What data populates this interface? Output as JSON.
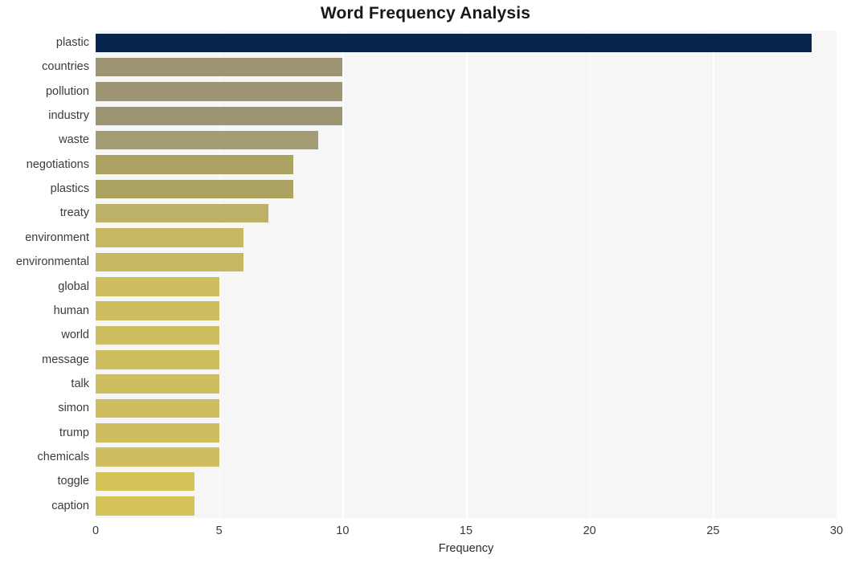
{
  "chart_data": {
    "type": "bar",
    "orientation": "horizontal",
    "title": "Word Frequency Analysis",
    "xlabel": "Frequency",
    "ylabel": "",
    "xlim": [
      0,
      30
    ],
    "ylim": null,
    "grid": true,
    "grid_axis": "x",
    "legend": null,
    "xticks": [
      0,
      5,
      10,
      15,
      20,
      25,
      30
    ],
    "xtick_labels": [
      "0",
      "5",
      "10",
      "15",
      "20",
      "25",
      "30"
    ],
    "categories": [
      "plastic",
      "countries",
      "pollution",
      "industry",
      "waste",
      "negotiations",
      "plastics",
      "treaty",
      "environment",
      "environmental",
      "global",
      "human",
      "world",
      "message",
      "talk",
      "simon",
      "trump",
      "chemicals",
      "toggle",
      "caption"
    ],
    "values": [
      29,
      10,
      10,
      10,
      9,
      8,
      8,
      7,
      6,
      6,
      5,
      5,
      5,
      5,
      5,
      5,
      5,
      5,
      4,
      4
    ],
    "bar_colors": [
      "#07264d",
      "#9d9572",
      "#9d9572",
      "#9d9572",
      "#a49c74",
      "#aca262",
      "#aca262",
      "#bdb067",
      "#c6b763",
      "#c6b763",
      "#cfbe60",
      "#cfbe60",
      "#cfbe60",
      "#cfbe60",
      "#cfbe60",
      "#cfbe60",
      "#cfbe60",
      "#cfbe60",
      "#d4c356",
      "#d4c356"
    ],
    "plot_background": "#f6f6f7",
    "gridline_color": "#ffffff",
    "figure_background": "#ffffff",
    "title_color": "#181818",
    "tick_color": "#3b3b3b"
  }
}
